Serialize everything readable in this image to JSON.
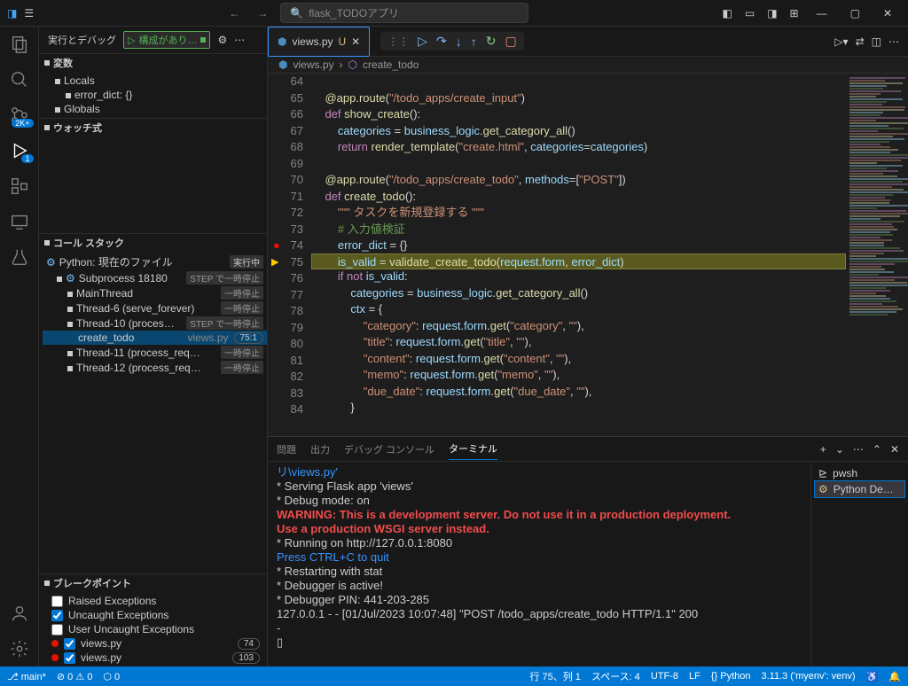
{
  "titlebar": {
    "search_placeholder": "flask_TODOアプリ"
  },
  "sidebar": {
    "title": "実行とデバッグ",
    "config_label": "構成があり…",
    "sections": {
      "variables": {
        "title": "変数",
        "locals": "Locals",
        "error_dict": "error_dict: {}",
        "globals": "Globals"
      },
      "watch": {
        "title": "ウォッチ式"
      },
      "callstack": {
        "title": "コール スタック",
        "items": [
          {
            "label": "Python: 現在のファイル",
            "status": "実行中",
            "icon": "⚙"
          },
          {
            "label": "Subprocess 18180",
            "status": "STEP で一時停止",
            "icon": "⚙",
            "indent": 1
          },
          {
            "label": "MainThread",
            "status": "一時停止",
            "indent": 2,
            "chev": ">"
          },
          {
            "label": "Thread-6 (serve_forever)",
            "status": "一時停止",
            "indent": 2,
            "chev": ">"
          },
          {
            "label": "Thread-10 (proces…",
            "status": "STEP で一時停止",
            "indent": 2,
            "chev": "v"
          },
          {
            "label": "create_todo",
            "file": "views.py",
            "line": "75:1",
            "indent": 3,
            "selected": true
          },
          {
            "label": "Thread-11 (process_req…",
            "status": "一時停止",
            "indent": 2,
            "chev": ">"
          },
          {
            "label": "Thread-12 (process_req…",
            "status": "一時停止",
            "indent": 2,
            "chev": ">"
          }
        ]
      },
      "breakpoints": {
        "title": "ブレークポイント",
        "raised": "Raised Exceptions",
        "uncaught": "Uncaught Exceptions",
        "user_uncaught": "User Uncaught Exceptions",
        "files": [
          {
            "name": "views.py",
            "count": "74"
          },
          {
            "name": "views.py",
            "count": "103"
          }
        ]
      }
    }
  },
  "editor": {
    "tab_name": "views.py",
    "tab_modified": "U",
    "breadcrumb": {
      "file": "views.py",
      "symbol": "create_todo"
    }
  },
  "code_lines": [
    {
      "n": 64,
      "h": ""
    },
    {
      "n": 65,
      "h": "    <span class='f'>@app.route</span>(<span class='s'>\"/todo_apps/create_input\"</span>)"
    },
    {
      "n": 66,
      "h": "    <span class='k'>def</span> <span class='f'>show_create</span>():"
    },
    {
      "n": 67,
      "h": "        <span class='n'>categories</span> = <span class='n'>business_logic</span>.<span class='f'>get_category_all</span>()"
    },
    {
      "n": 68,
      "h": "        <span class='k'>return</span> <span class='f'>render_template</span>(<span class='s'>\"create.html\"</span>, <span class='n'>categories</span>=<span class='n'>categories</span>)"
    },
    {
      "n": 69,
      "h": ""
    },
    {
      "n": 70,
      "h": "    <span class='f'>@app.route</span>(<span class='s'>\"/todo_apps/create_todo\"</span>, <span class='n'>methods</span>=[<span class='s'>\"POST\"</span>])"
    },
    {
      "n": 71,
      "h": "    <span class='k'>def</span> <span class='f'>create_todo</span>():"
    },
    {
      "n": 72,
      "h": "        <span class='s'>\"\"\" タスクを新規登録する \"\"\"</span>"
    },
    {
      "n": 73,
      "h": "        <span class='c'># 入力値検証</span>"
    },
    {
      "n": 74,
      "h": "        <span class='n'>error_dict</span> = {}",
      "bp": true
    },
    {
      "n": 75,
      "h": "        <span class='n'>is_valid</span> = <span class='f'>validate_create_todo</span>(<span class='n'>request</span>.<span class='n'>form</span>, <span class='n'>error_dict</span>)",
      "cur": true,
      "hl": true
    },
    {
      "n": 76,
      "h": "        <span class='k'>if</span> <span class='k'>not</span> <span class='n'>is_valid</span>:"
    },
    {
      "n": 77,
      "h": "            <span class='n'>categories</span> = <span class='n'>business_logic</span>.<span class='f'>get_category_all</span>()"
    },
    {
      "n": 78,
      "h": "            <span class='n'>ctx</span> = {"
    },
    {
      "n": 79,
      "h": "                <span class='s'>\"category\"</span>: <span class='n'>request</span>.<span class='n'>form</span>.<span class='f'>get</span>(<span class='s'>\"category\"</span>, <span class='s'>\"\"</span>),"
    },
    {
      "n": 80,
      "h": "                <span class='s'>\"title\"</span>: <span class='n'>request</span>.<span class='n'>form</span>.<span class='f'>get</span>(<span class='s'>\"title\"</span>, <span class='s'>\"\"</span>),"
    },
    {
      "n": 81,
      "h": "                <span class='s'>\"content\"</span>: <span class='n'>request</span>.<span class='n'>form</span>.<span class='f'>get</span>(<span class='s'>\"content\"</span>, <span class='s'>\"\"</span>),"
    },
    {
      "n": 82,
      "h": "                <span class='s'>\"memo\"</span>: <span class='n'>request</span>.<span class='n'>form</span>.<span class='f'>get</span>(<span class='s'>\"memo\"</span>, <span class='s'>\"\"</span>),"
    },
    {
      "n": 83,
      "h": "                <span class='s'>\"due_date\"</span>: <span class='n'>request</span>.<span class='n'>form</span>.<span class='f'>get</span>(<span class='s'>\"due_date\"</span>, <span class='s'>\"\"</span>),"
    },
    {
      "n": 84,
      "h": "            }"
    }
  ],
  "terminal": {
    "tabs": {
      "problems": "問題",
      "output": "出力",
      "debug_console": "デバッグ コンソール",
      "terminal": "ターミナル"
    },
    "side": {
      "pwsh": "pwsh",
      "python": "Python De…"
    },
    "lines": [
      {
        "t": "リ\\views.py'",
        "cls": "info"
      },
      {
        "t": " * Serving Flask app 'views'"
      },
      {
        "t": " * Debug mode: on"
      },
      {
        "t": "WARNING: This is a development server. Do not use it in a production deployment.",
        "cls": "warn"
      },
      {
        "t": "Use a production WSGI server instead.",
        "cls": "warn"
      },
      {
        "t": " * Running on http://127.0.0.1:8080"
      },
      {
        "t": "Press CTRL+C to quit",
        "cls": "info"
      },
      {
        "t": " * Restarting with stat"
      },
      {
        "t": " * Debugger is active!"
      },
      {
        "t": " * Debugger PIN: 441-203-285"
      },
      {
        "t": "127.0.0.1 - - [01/Jul/2023 10:07:48] \"POST /todo_apps/create_todo HTTP/1.1\" 200"
      },
      {
        "t": "-"
      },
      {
        "t": "▯"
      }
    ]
  },
  "statusbar": {
    "items_left": [
      "⎇ main*",
      "⊘ 0 ⚠ 0",
      "⬡ 0"
    ],
    "items_right": [
      "行 75、列 1",
      "スペース: 4",
      "UTF-8",
      "LF",
      "{} Python",
      "3.11.3 ('myenv': venv)",
      "♿",
      "🔔"
    ]
  },
  "icons": {
    "vscode": "⧉",
    "menu": "☰",
    "search": "🔍",
    "files": "🗎",
    "search_act": "🔍",
    "scm": "⎇",
    "debug": "▷",
    "ext": "⊞",
    "test": "⚗",
    "remote": "▭",
    "account": "◯",
    "gear": "⚙"
  }
}
